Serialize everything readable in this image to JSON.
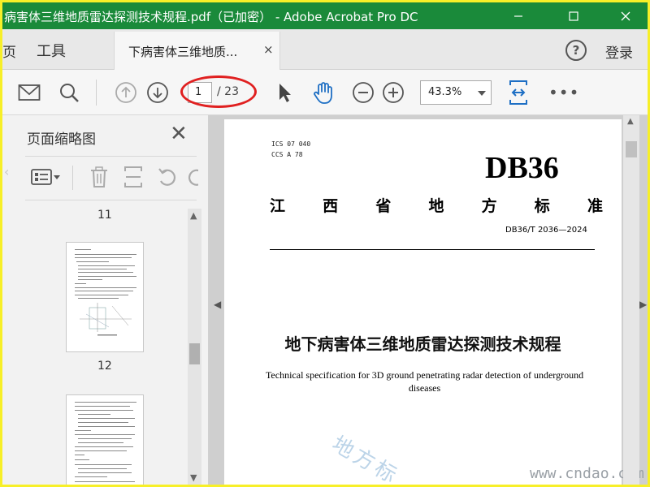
{
  "window": {
    "title": "病害体三维地质雷达探测技术规程.pdf（已加密） - Adobe Acrobat Pro DC"
  },
  "tabs": {
    "home_fragment": "页",
    "tools": "工具",
    "document": "下病害体三维地质...",
    "close_glyph": "×"
  },
  "header": {
    "help": "?",
    "login": "登录"
  },
  "toolbar": {
    "page_current": "1",
    "page_total": "/ 23",
    "zoom": "43.3%",
    "more": "•••"
  },
  "thumbnails": {
    "title": "页面缩略图",
    "close_glyph": "✕",
    "pages": [
      {
        "number": "11"
      },
      {
        "number": "12"
      }
    ]
  },
  "document": {
    "ics_line1": "ICS 07 040",
    "ics_line2": "CCS A 78",
    "logo": "DB36",
    "province_chars": [
      "江",
      "西",
      "省",
      "地",
      "方",
      "标",
      "准"
    ],
    "standard_number": "DB36/T 2036—2024",
    "title_cn": "地下病害体三维地质雷达探测技术规程",
    "title_en": "Technical specification for 3D ground penetrating radar detection of underground diseases"
  },
  "watermark": {
    "cn": "地方标",
    "url": "www.cndao.com"
  },
  "colors": {
    "title_bar": "#1a8a3a",
    "accent_blue": "#1e6fc4",
    "annotation_red": "#e02020",
    "frame_yellow": "#f7ef28"
  }
}
